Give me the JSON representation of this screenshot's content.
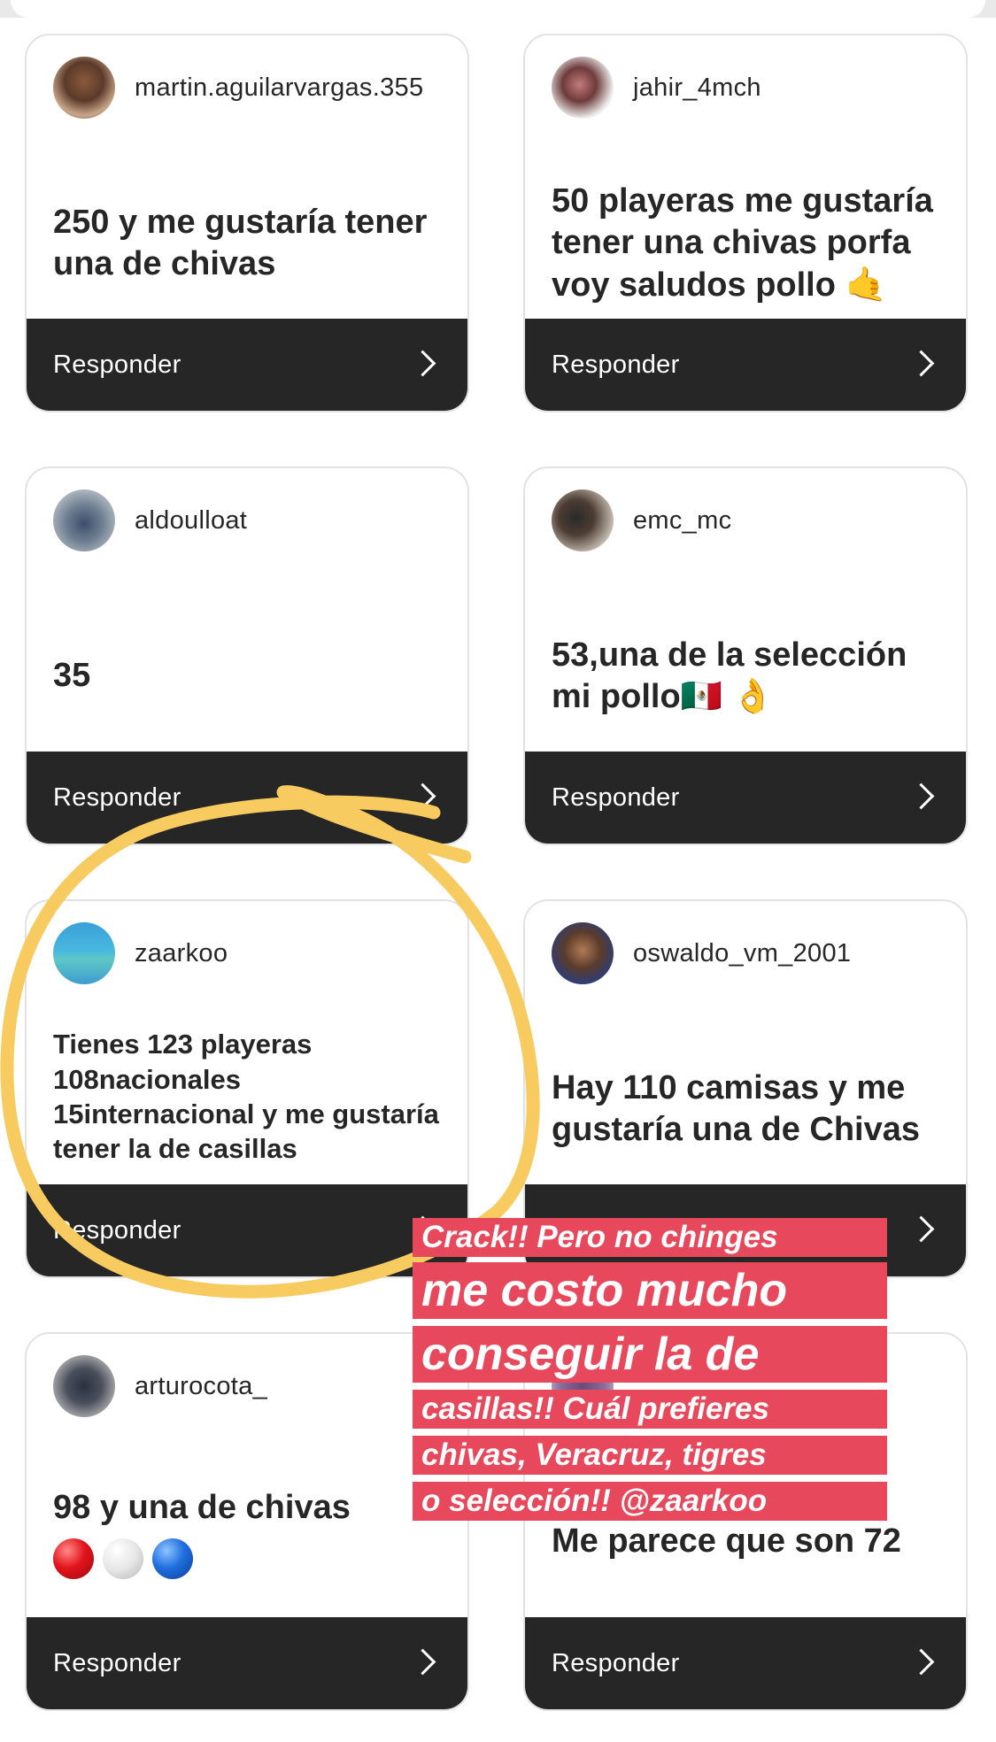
{
  "reply_label": "Responder",
  "cards": [
    {
      "username": "martin.aguilarvargas.355",
      "message": "250 y me gustaría tener una de chivas"
    },
    {
      "username": "jahir_4mch",
      "message": "50 playeras me gustaría tener una chivas porfa voy saludos pollo 🤙"
    },
    {
      "username": "aldoulloat",
      "message": "35"
    },
    {
      "username": "emc_mc",
      "message": "53,una de la selección mi pollo🇲🇽 👌"
    },
    {
      "username": "zaarkoo",
      "message": "Tienes 123 playeras 108nacionales 15internacional y me gustaría tener la de casillas"
    },
    {
      "username": "oswaldo_vm_2001",
      "message": "Hay 110 camisas y me gustaría una de Chivas"
    },
    {
      "username": "arturocota_",
      "message": "98 y una de chivas"
    },
    {
      "username": "",
      "message": "Me parece que son 72"
    }
  ],
  "overlay": {
    "lines": [
      "Crack!! Pero no chinges",
      "me costo mucho",
      "conseguir la de",
      "casillas!! Cuál prefieres",
      "chivas, Veracruz, tigres",
      "o selección!! @zaarkoo"
    ],
    "background": "#e8485c"
  },
  "colors": {
    "reply_bar": "#262626",
    "highlight_circle": "#f7cb5f"
  }
}
